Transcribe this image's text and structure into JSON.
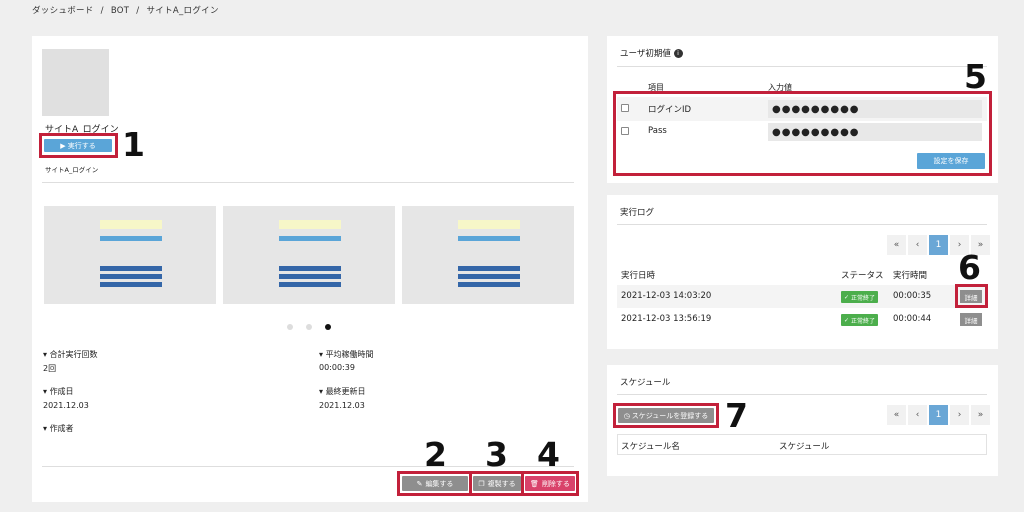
{
  "breadcrumb": {
    "item1": "ダッシュボード",
    "sep1": "/",
    "item2": "BOT",
    "sep2": "/",
    "item3": "サイトA_ログイン"
  },
  "bot": {
    "title": "サイトA_ログイン",
    "run_label": "▶ 実行する",
    "caption": "サイトA_ログイン",
    "stats": {
      "total_runs_label": "合計実行回数",
      "total_runs_value": "2回",
      "avg_time_label": "平均稼働時間",
      "avg_time_value": "00:00:39",
      "created_label": "作成日",
      "created_value": "2021.12.03",
      "updated_label": "最終更新日",
      "updated_value": "2021.12.03",
      "author_label": "作成者"
    },
    "carousel": {
      "slide_count": 3,
      "active_index": 2
    },
    "actions": {
      "edit": "編集する",
      "copy": "複製する",
      "delete": "削除する"
    }
  },
  "annotations": [
    "1",
    "2",
    "3",
    "4",
    "5",
    "6",
    "7"
  ],
  "user_defaults": {
    "title": "ユーザ初期値",
    "header_item": "項目",
    "header_value": "入力値",
    "rows": [
      {
        "label": "ログインID",
        "value": "●●●●●●●●●"
      },
      {
        "label": "Pass",
        "value": "●●●●●●●●●"
      }
    ],
    "save_label": "設定を保存"
  },
  "exec_log": {
    "title": "実行ログ",
    "pager": {
      "first": "«",
      "prev": "‹",
      "page": "1",
      "next": "›",
      "last": "»"
    },
    "headers": {
      "date": "実行日時",
      "status": "ステータス",
      "time": "実行時間"
    },
    "rows": [
      {
        "date": "2021-12-03 14:03:20",
        "status": "正常終了",
        "time": "00:00:35",
        "detail": "詳細"
      },
      {
        "date": "2021-12-03 13:56:19",
        "status": "正常終了",
        "time": "00:00:44",
        "detail": "詳細"
      }
    ]
  },
  "schedule": {
    "title": "スケジュール",
    "register_label": "スケジュールを登録する",
    "pager": {
      "first": "«",
      "prev": "‹",
      "page": "1",
      "next": "›",
      "last": "»"
    },
    "headers": {
      "name": "スケジュール名",
      "schedule": "スケジュール"
    }
  },
  "colors": {
    "primary": "#5aa5d8",
    "danger": "#d9426a",
    "gray_button": "#8e8e8e",
    "success": "#4cae4c",
    "annotation_red": "#c2203a"
  }
}
